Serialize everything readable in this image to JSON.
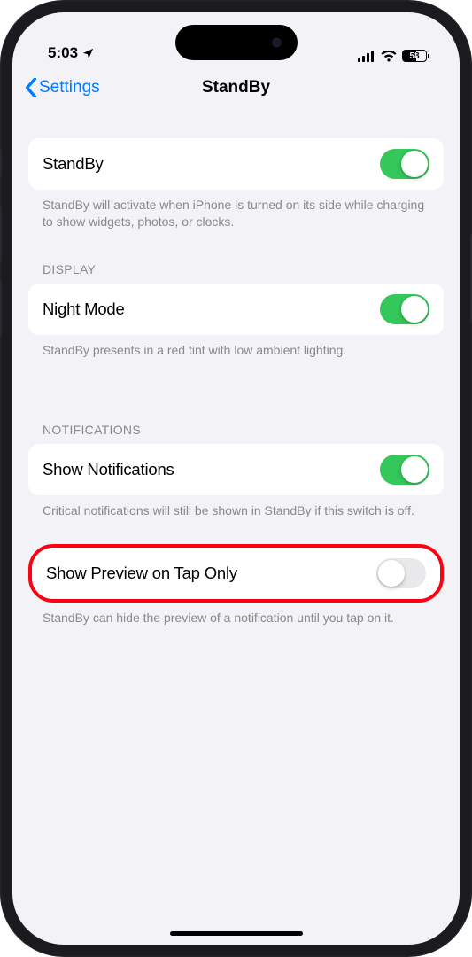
{
  "status": {
    "time": "5:03",
    "battery_percent": "58"
  },
  "nav": {
    "back_label": "Settings",
    "title": "StandBy"
  },
  "groups": {
    "standby": {
      "label": "StandBy",
      "enabled": true,
      "footer": "StandBy will activate when iPhone is turned on its side while charging to show widgets, photos, or clocks."
    },
    "display": {
      "header": "DISPLAY",
      "night_mode": {
        "label": "Night Mode",
        "enabled": true
      },
      "footer": "StandBy presents in a red tint with low ambient lighting."
    },
    "notifications": {
      "header": "NOTIFICATIONS",
      "show_notifications": {
        "label": "Show Notifications",
        "enabled": true
      },
      "show_notifications_footer": "Critical notifications will still be shown in StandBy if this switch is off.",
      "preview_tap": {
        "label": "Show Preview on Tap Only",
        "enabled": false
      },
      "preview_tap_footer": "StandBy can hide the preview of a notification until you tap on it."
    }
  }
}
